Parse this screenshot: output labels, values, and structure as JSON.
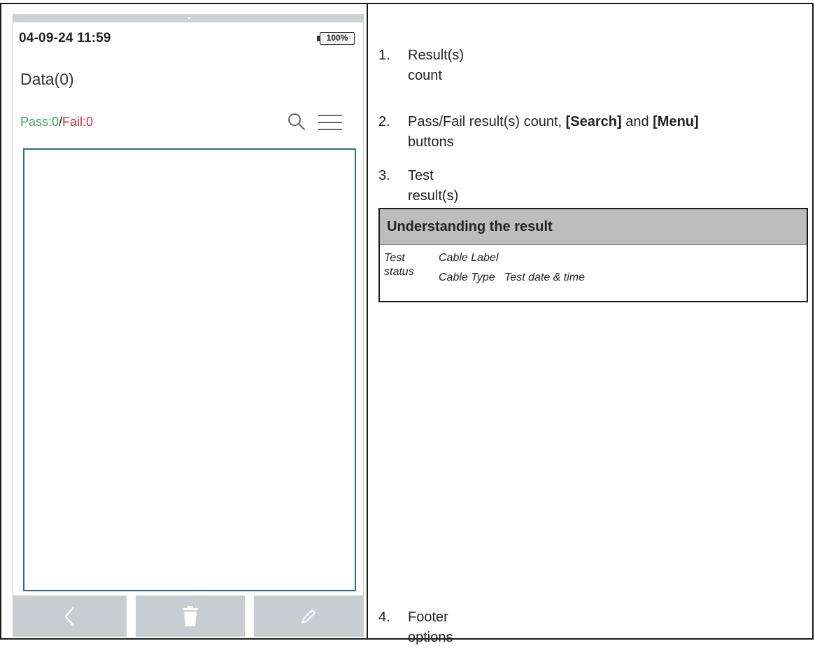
{
  "device": {
    "status_time": "04-09-24 11:59",
    "battery_label": "100%",
    "title": "Data(0)",
    "pass_label": "Pass:0",
    "separator": "/",
    "fail_label": "Fail:0",
    "icons": {
      "search": "search-icon",
      "menu": "menu-icon",
      "back": "chevron-left-icon",
      "delete": "trash-icon",
      "edit": "pencil-icon"
    },
    "colors": {
      "pass": "#3aa35e",
      "fail": "#c8303a",
      "list_border": "#2c6f80",
      "footer_button": "#c9cdd1"
    }
  },
  "descriptions": [
    {
      "num": "1.",
      "text": "Result(s) count"
    },
    {
      "num": "2.",
      "text_before": "Pass/Fail result(s) count, ",
      "bold1": "[Search]",
      "text_mid": " and ",
      "bold2": "[Menu]",
      "text_after": "buttons"
    },
    {
      "num": "3.",
      "text": "Test result(s) list"
    },
    {
      "num": "4.",
      "text": "Footer options"
    }
  ],
  "legend": {
    "title": "Understanding the result",
    "test": "Test",
    "status": "status",
    "cable_label": "Cable Label",
    "cable_type": "Cable Type",
    "test_datetime": "Test date & time"
  }
}
